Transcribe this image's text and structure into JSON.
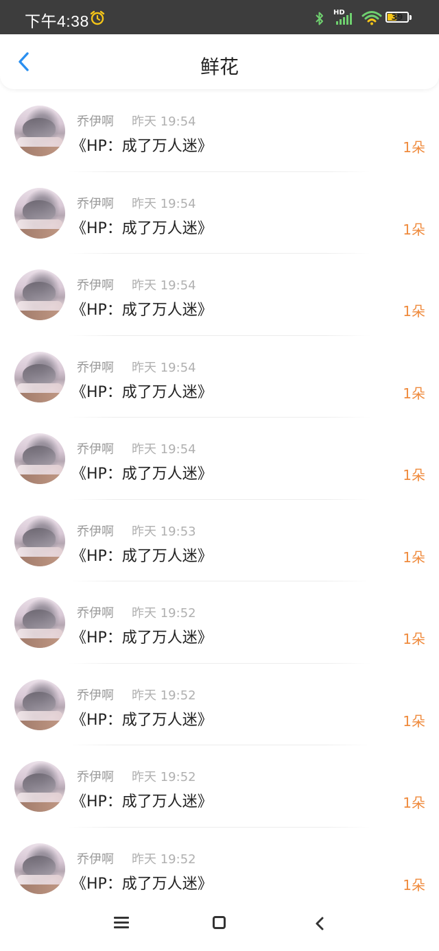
{
  "status_bar": {
    "time": "下午4:38",
    "network_label": "HD",
    "battery_level": "39",
    "icons": [
      "alarm-icon",
      "bluetooth-icon",
      "signal-icon",
      "wifi-icon",
      "battery-icon"
    ]
  },
  "header": {
    "title": "鲜花",
    "back_icon": "chevron-left-icon",
    "back_color": "#2a8ff0"
  },
  "colors": {
    "accent_orange": "#ef8a3c",
    "name_gray": "#9a9a9a",
    "time_gray": "#b0b0b0",
    "title_text": "#222222"
  },
  "list": {
    "items": [
      {
        "sender": "乔伊啊",
        "time": "昨天 19:54",
        "book": "《HP：成了万人迷》",
        "count": "1朵"
      },
      {
        "sender": "乔伊啊",
        "time": "昨天 19:54",
        "book": "《HP：成了万人迷》",
        "count": "1朵"
      },
      {
        "sender": "乔伊啊",
        "time": "昨天 19:54",
        "book": "《HP：成了万人迷》",
        "count": "1朵"
      },
      {
        "sender": "乔伊啊",
        "time": "昨天 19:54",
        "book": "《HP：成了万人迷》",
        "count": "1朵"
      },
      {
        "sender": "乔伊啊",
        "time": "昨天 19:54",
        "book": "《HP：成了万人迷》",
        "count": "1朵"
      },
      {
        "sender": "乔伊啊",
        "time": "昨天 19:53",
        "book": "《HP：成了万人迷》",
        "count": "1朵"
      },
      {
        "sender": "乔伊啊",
        "time": "昨天 19:52",
        "book": "《HP：成了万人迷》",
        "count": "1朵"
      },
      {
        "sender": "乔伊啊",
        "time": "昨天 19:52",
        "book": "《HP：成了万人迷》",
        "count": "1朵"
      },
      {
        "sender": "乔伊啊",
        "time": "昨天 19:52",
        "book": "《HP：成了万人迷》",
        "count": "1朵"
      },
      {
        "sender": "乔伊啊",
        "time": "昨天 19:52",
        "book": "《HP：成了万人迷》",
        "count": "1朵"
      }
    ]
  },
  "nav_bar": {
    "icons": [
      "menu-icon",
      "home-icon",
      "back-icon"
    ]
  }
}
